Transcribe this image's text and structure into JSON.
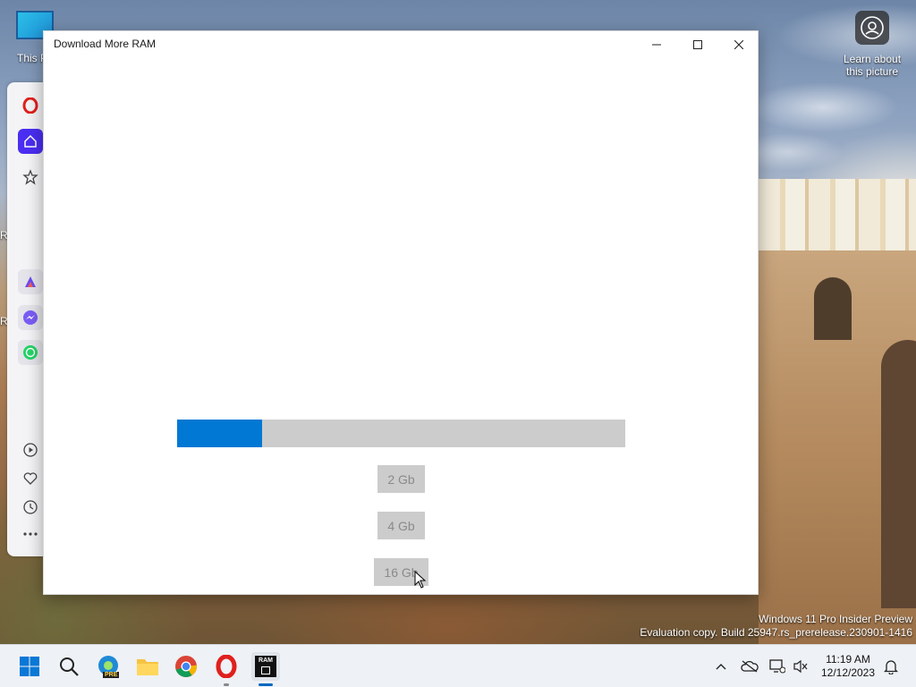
{
  "desktop": {
    "this_pc_label": "This P",
    "spotlight_label_line1": "Learn about",
    "spotlight_label_line2": "this picture",
    "edge_letter_1": "R",
    "edge_letter_2": "R"
  },
  "window": {
    "title": "Download More RAM",
    "progress": 0.19,
    "buttons": [
      {
        "label": "2 Gb"
      },
      {
        "label": "4 Gb"
      },
      {
        "label": "16 Gb"
      }
    ]
  },
  "watermark": {
    "line1": "Windows 11 Pro Insider Preview",
    "line2": "Evaluation copy. Build 25947.rs_prerelease.230901-1416"
  },
  "taskbar": {
    "time": "11:19 AM",
    "date": "12/12/2023",
    "edge_badge": "PRE",
    "ram_app_icon_text": "RAM"
  },
  "colors": {
    "accent": "#0078d4",
    "button_bg": "#cccccc",
    "button_text": "#8a8a8a"
  }
}
